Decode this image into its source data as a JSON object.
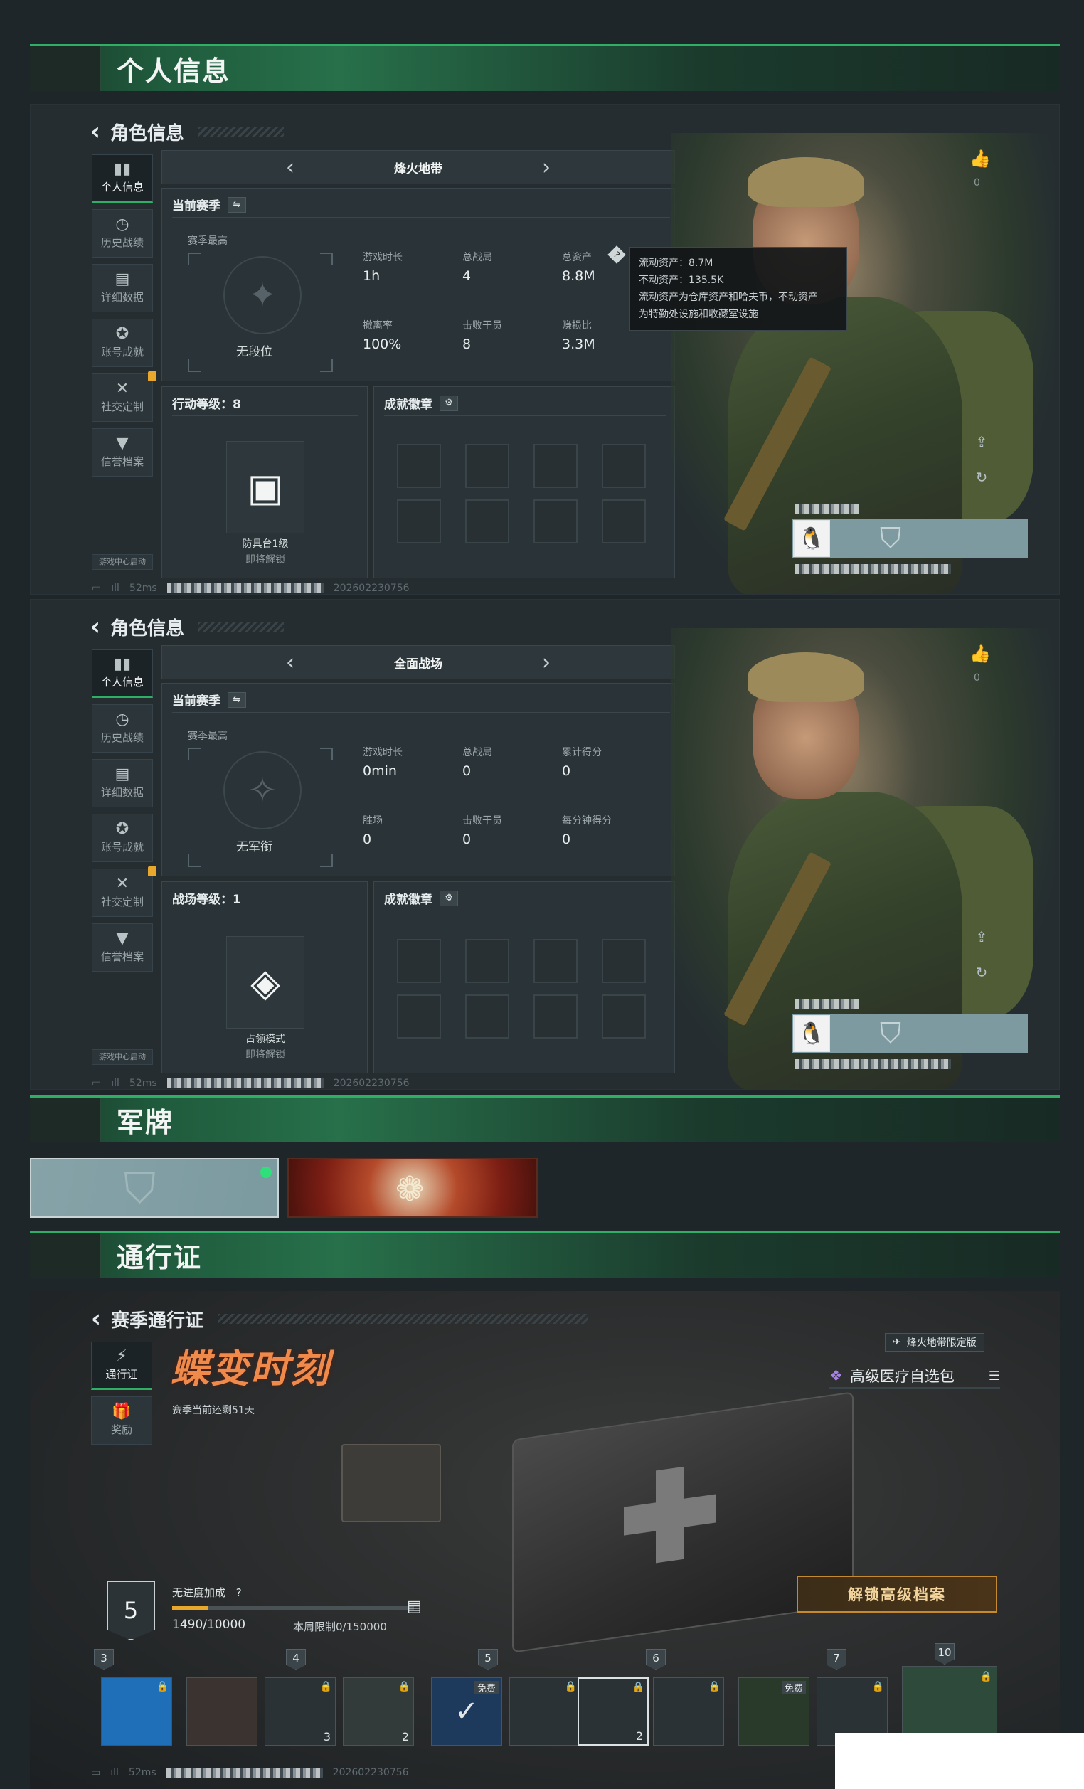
{
  "sections": {
    "personal_info": "个人信息",
    "military_plate": "军牌",
    "pass": "通行证"
  },
  "panel1": {
    "back_title": "角色信息",
    "nav": [
      "个人信息",
      "历史战绩",
      "详细数据",
      "账号成就",
      "社交定制",
      "信誉档案"
    ],
    "mode": "烽火地带",
    "season_title": "当前赛季",
    "season_best": "赛季最高",
    "rank": "无段位",
    "stats": [
      {
        "label": "游戏时长",
        "value": "1h"
      },
      {
        "label": "总战局",
        "value": "4"
      },
      {
        "label": "总资产",
        "value": "8.8M"
      },
      {
        "label": "撤离率",
        "value": "100%"
      },
      {
        "label": "击败干员",
        "value": "8"
      },
      {
        "label": "赚损比",
        "value": "3.3M"
      }
    ],
    "tooltip": {
      "line1": "流动资产：8.7M",
      "line2": "不动资产：135.5K",
      "line3": "流动资产为仓库资产和哈夫币，不动资产",
      "line4": "为特勤处设施和收藏室设施"
    },
    "level_title": "行动等级：8",
    "badges_title": "成就徽章",
    "unlock_name": "防具台1级",
    "unlock_sub": "即将解锁",
    "like_count": "0",
    "game_center": "游戏中心启动",
    "ping": "52ms",
    "uid": "202602230756"
  },
  "panel2": {
    "back_title": "角色信息",
    "nav": [
      "个人信息",
      "历史战绩",
      "详细数据",
      "账号成就",
      "社交定制",
      "信誉档案"
    ],
    "mode": "全面战场",
    "season_title": "当前赛季",
    "season_best": "赛季最高",
    "rank": "无军衔",
    "stats": [
      {
        "label": "游戏时长",
        "value": "0min"
      },
      {
        "label": "总战局",
        "value": "0"
      },
      {
        "label": "累计得分",
        "value": "0"
      },
      {
        "label": "胜场",
        "value": "0"
      },
      {
        "label": "击败干员",
        "value": "0"
      },
      {
        "label": "每分钟得分",
        "value": "0"
      }
    ],
    "level_title": "战场等级：1",
    "badges_title": "成就徽章",
    "unlock_name": "占领模式",
    "unlock_sub": "即将解锁",
    "like_count": "0",
    "game_center": "游戏中心启动",
    "ping": "52ms",
    "uid": "202602230756"
  },
  "pass": {
    "back_title": "赛季通行证",
    "nav": [
      "通行证",
      "奖励"
    ],
    "season_name": "蝶变时刻",
    "season_remaining": "赛季当前还剩51天",
    "edition_tag": "烽火地带限定版",
    "item_name": "高级医疗自选包",
    "level": "5",
    "bonus_label": "无进度加成",
    "bonus_help": "?",
    "progress_text": "1490/10000",
    "progress": 0.149,
    "weekly_limit": "本周限制0/150000",
    "unlock_button": "解锁高级档案",
    "level_markers": [
      "3",
      "4",
      "5",
      "6",
      "7",
      "10"
    ],
    "reward_counts": [
      "3",
      "2",
      "2"
    ],
    "free_label": "免费",
    "ping": "52ms",
    "uid": "202602230756"
  },
  "colors": {
    "accent_green": "#2fae66",
    "gold": "#c58a30",
    "profile_strip": "#7d9aa0"
  }
}
